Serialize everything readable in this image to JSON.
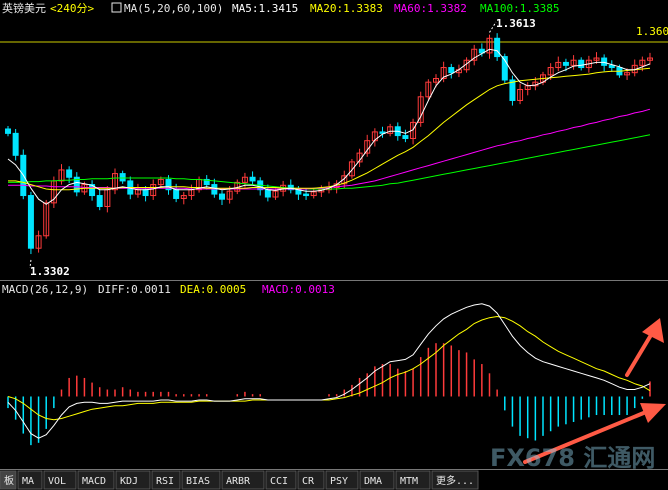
{
  "header": {
    "symbol": "英镑美元",
    "period": "<240分>",
    "ma_params": "MA(5,20,60,100)",
    "ma5": "MA5:1.3415",
    "ma20": "MA20:1.3383",
    "ma60": "MA60:1.3382",
    "ma100": "MA100:1.3385"
  },
  "price_labels": {
    "high": "1.3613",
    "low": "1.3302",
    "right_level": "1.3600"
  },
  "macd_header": {
    "params": "MACD(26,12,9)",
    "diff": "DIFF:0.0011",
    "dea": "DEA:0.0005",
    "macd": "MACD:0.0013"
  },
  "tabs": [
    "板",
    "MA",
    "VOL",
    "MACD",
    "KDJ",
    "RSI",
    "BIAS",
    "ARBR",
    "CCI",
    "CR",
    "PSY",
    "DMA",
    "MTM",
    "更多..."
  ],
  "watermark": "FX678 汇通网",
  "colors": {
    "up": "#ff3b3b",
    "down": "#00e5ff",
    "ma5": "#ffffff",
    "ma20": "#ffff00",
    "ma60": "#ff00ff",
    "ma100": "#00ff00",
    "arrow": "#ff5a45",
    "level_line": "#cccc00"
  },
  "chart_data": [
    {
      "type": "candlestick",
      "series_names": [
        "MA5",
        "MA20",
        "MA60",
        "MA100"
      ],
      "ylim": [
        1.328,
        1.363
      ],
      "level_line": 1.36,
      "annotations": [
        {
          "label": "1.3613",
          "value": 1.3613
        },
        {
          "label": "1.3302",
          "value": 1.3302
        }
      ],
      "close": [
        1.3475,
        1.3445,
        1.339,
        1.3318,
        1.3335,
        1.338,
        1.341,
        1.3425,
        1.3415,
        1.3395,
        1.3405,
        1.339,
        1.3375,
        1.3398,
        1.342,
        1.341,
        1.3392,
        1.3398,
        1.339,
        1.3405,
        1.3412,
        1.3398,
        1.3386,
        1.339,
        1.3398,
        1.3412,
        1.3405,
        1.3392,
        1.3385,
        1.3396,
        1.3408,
        1.3415,
        1.341,
        1.3398,
        1.3388,
        1.3396,
        1.3404,
        1.3398,
        1.3392,
        1.339,
        1.3395,
        1.3398,
        1.3401,
        1.3406,
        1.3417,
        1.3436,
        1.3448,
        1.3465,
        1.3477,
        1.3475,
        1.3484,
        1.3472,
        1.3468,
        1.349,
        1.3525,
        1.3545,
        1.355,
        1.3565,
        1.3558,
        1.3562,
        1.3575,
        1.359,
        1.3585,
        1.3605,
        1.358,
        1.3548,
        1.352,
        1.3535,
        1.354,
        1.3545,
        1.3555,
        1.3565,
        1.3572,
        1.3568,
        1.3575,
        1.3565,
        1.3575,
        1.3578,
        1.3568,
        1.3565,
        1.3555,
        1.3558,
        1.3568,
        1.3575,
        1.3578
      ],
      "ma5": [
        1.344,
        1.3432,
        1.3418,
        1.34,
        1.3385,
        1.3378,
        1.3385,
        1.3398,
        1.3405,
        1.3408,
        1.3406,
        1.3404,
        1.3398,
        1.3398,
        1.34,
        1.3402,
        1.34,
        1.3398,
        1.3398,
        1.3399,
        1.3402,
        1.3402,
        1.3398,
        1.3398,
        1.3398,
        1.34,
        1.3402,
        1.34,
        1.3398,
        1.3399,
        1.3401,
        1.3404,
        1.3404,
        1.3402,
        1.3398,
        1.3397,
        1.3399,
        1.34,
        1.3398,
        1.3396,
        1.3396,
        1.3397,
        1.34,
        1.3405,
        1.3413,
        1.3425,
        1.3438,
        1.3452,
        1.3466,
        1.3474,
        1.3478,
        1.3478,
        1.3475,
        1.348,
        1.3498,
        1.352,
        1.354,
        1.3552,
        1.3556,
        1.3562,
        1.357,
        1.3578,
        1.3584,
        1.359,
        1.3588,
        1.3575,
        1.3558,
        1.3545,
        1.354,
        1.3541,
        1.3545,
        1.3552,
        1.3558,
        1.3562,
        1.3567,
        1.3568,
        1.357,
        1.3572,
        1.3572,
        1.3569,
        1.3566,
        1.3562,
        1.3562,
        1.3566,
        1.357
      ],
      "ma20": [
        1.341,
        1.341,
        1.3408,
        1.3405,
        1.3402,
        1.3399,
        1.3398,
        1.3398,
        1.3398,
        1.3399,
        1.34,
        1.34,
        1.34,
        1.34,
        1.34,
        1.3401,
        1.3401,
        1.3401,
        1.3401,
        1.3401,
        1.3401,
        1.3402,
        1.3402,
        1.3402,
        1.3401,
        1.3401,
        1.34,
        1.34,
        1.34,
        1.34,
        1.34,
        1.34,
        1.3401,
        1.3401,
        1.3401,
        1.3401,
        1.34,
        1.34,
        1.34,
        1.34,
        1.34,
        1.3401,
        1.3402,
        1.3404,
        1.3407,
        1.3411,
        1.3416,
        1.3421,
        1.3427,
        1.3433,
        1.3439,
        1.3445,
        1.345,
        1.3456,
        1.3464,
        1.3472,
        1.3481,
        1.349,
        1.3498,
        1.3506,
        1.3514,
        1.3521,
        1.3528,
        1.3535,
        1.354,
        1.3543,
        1.3545,
        1.3547,
        1.3548,
        1.3549,
        1.355,
        1.3551,
        1.3552,
        1.3553,
        1.3554,
        1.3555,
        1.3556,
        1.3558,
        1.3559,
        1.356,
        1.356,
        1.3561,
        1.3562,
        1.3563,
        1.3564
      ],
      "ma60": [
        1.3404,
        1.3404,
        1.3404,
        1.3403,
        1.3403,
        1.3403,
        1.3402,
        1.3402,
        1.3402,
        1.3402,
        1.3401,
        1.3401,
        1.3401,
        1.3401,
        1.34,
        1.34,
        1.34,
        1.34,
        1.34,
        1.34,
        1.34,
        1.34,
        1.34,
        1.34,
        1.3399,
        1.3399,
        1.3399,
        1.3399,
        1.3399,
        1.3399,
        1.3399,
        1.3399,
        1.3399,
        1.3399,
        1.3399,
        1.3399,
        1.3399,
        1.3399,
        1.3399,
        1.3399,
        1.34,
        1.34,
        1.3401,
        1.3402,
        1.3403,
        1.3404,
        1.3406,
        1.3408,
        1.341,
        1.3413,
        1.3416,
        1.3419,
        1.3422,
        1.3425,
        1.3428,
        1.3431,
        1.3434,
        1.3437,
        1.344,
        1.3443,
        1.3446,
        1.3449,
        1.3452,
        1.3455,
        1.3458,
        1.346,
        1.3463,
        1.3465,
        1.3468,
        1.347,
        1.3473,
        1.3475,
        1.3478,
        1.348,
        1.3483,
        1.3485,
        1.3488,
        1.349,
        1.3493,
        1.3495,
        1.3498,
        1.35,
        1.3503,
        1.3505,
        1.3508
      ],
      "ma100": [
        1.3408,
        1.3408,
        1.3408,
        1.3409,
        1.3409,
        1.341,
        1.341,
        1.3411,
        1.3411,
        1.3412,
        1.3412,
        1.3413,
        1.3413,
        1.3413,
        1.3414,
        1.3414,
        1.3414,
        1.3414,
        1.3414,
        1.3414,
        1.3414,
        1.3414,
        1.3413,
        1.3413,
        1.3412,
        1.3412,
        1.3411,
        1.341,
        1.3409,
        1.3408,
        1.3407,
        1.3406,
        1.3405,
        1.3404,
        1.3403,
        1.3402,
        1.3401,
        1.34,
        1.34,
        1.3399,
        1.3399,
        1.3399,
        1.3399,
        1.3399,
        1.34,
        1.34,
        1.3401,
        1.3402,
        1.3403,
        1.3404,
        1.3406,
        1.3407,
        1.3409,
        1.3411,
        1.3413,
        1.3415,
        1.3417,
        1.3419,
        1.3421,
        1.3423,
        1.3425,
        1.3427,
        1.3429,
        1.3431,
        1.3433,
        1.3435,
        1.3437,
        1.3439,
        1.3441,
        1.3443,
        1.3445,
        1.3447,
        1.3449,
        1.3451,
        1.3453,
        1.3455,
        1.3457,
        1.3459,
        1.3461,
        1.3463,
        1.3465,
        1.3467,
        1.3469,
        1.3471,
        1.3473
      ]
    },
    {
      "type": "bar+line",
      "series_names": [
        "DIFF",
        "DEA",
        "MACD"
      ],
      "ylim": [
        -0.006,
        0.0085
      ],
      "diff": [
        -0.0005,
        -0.0012,
        -0.0022,
        -0.0032,
        -0.0036,
        -0.0033,
        -0.0025,
        -0.0016,
        -0.0009,
        -0.0006,
        -0.0005,
        -0.0005,
        -0.0006,
        -0.0006,
        -0.0005,
        -0.0004,
        -0.0004,
        -0.0004,
        -0.0004,
        -0.0004,
        -0.0003,
        -0.0003,
        -0.0004,
        -0.0004,
        -0.0004,
        -0.0003,
        -0.0003,
        -0.0004,
        -0.0004,
        -0.0004,
        -0.0003,
        -0.0002,
        -0.0002,
        -0.0002,
        -0.0003,
        -0.0003,
        -0.0003,
        -0.0003,
        -0.0003,
        -0.0003,
        -0.0003,
        -0.0003,
        -0.0002,
        -0.0001,
        0.0002,
        0.0006,
        0.0011,
        0.0016,
        0.0022,
        0.0026,
        0.003,
        0.0031,
        0.0032,
        0.0036,
        0.0045,
        0.0054,
        0.0061,
        0.0067,
        0.0071,
        0.0074,
        0.0077,
        0.0079,
        0.008,
        0.0078,
        0.0072,
        0.0062,
        0.0052,
        0.0044,
        0.0038,
        0.0033,
        0.003,
        0.0028,
        0.0026,
        0.0024,
        0.0022,
        0.002,
        0.0018,
        0.0016,
        0.0014,
        0.0011,
        0.0008,
        0.0006,
        0.0006,
        0.0008,
        0.0011
      ],
      "dea": [
        0.0,
        -0.0002,
        -0.0006,
        -0.0011,
        -0.0016,
        -0.0019,
        -0.002,
        -0.0019,
        -0.0017,
        -0.0015,
        -0.0013,
        -0.0011,
        -0.001,
        -0.0009,
        -0.0008,
        -0.0008,
        -0.0007,
        -0.0006,
        -0.0006,
        -0.0006,
        -0.0005,
        -0.0005,
        -0.0005,
        -0.0005,
        -0.0005,
        -0.0004,
        -0.0004,
        -0.0004,
        -0.0004,
        -0.0004,
        -0.0004,
        -0.0004,
        -0.0003,
        -0.0003,
        -0.0003,
        -0.0003,
        -0.0003,
        -0.0003,
        -0.0003,
        -0.0003,
        -0.0003,
        -0.0003,
        -0.0003,
        -0.0002,
        -0.0001,
        0.0001,
        0.0003,
        0.0006,
        0.0009,
        0.0012,
        0.0016,
        0.0019,
        0.0021,
        0.0024,
        0.0028,
        0.0033,
        0.0038,
        0.0044,
        0.0049,
        0.0054,
        0.0058,
        0.0063,
        0.0066,
        0.0068,
        0.0069,
        0.0068,
        0.0065,
        0.0061,
        0.0056,
        0.0052,
        0.0047,
        0.0043,
        0.0039,
        0.0036,
        0.0033,
        0.003,
        0.0027,
        0.0024,
        0.0022,
        0.0019,
        0.0016,
        0.0014,
        0.0011,
        0.0009,
        0.0005
      ],
      "macd": [
        -0.001,
        -0.002,
        -0.0032,
        -0.0042,
        -0.004,
        -0.0028,
        -0.001,
        0.0006,
        0.0016,
        0.0018,
        0.0016,
        0.0012,
        0.0008,
        0.0006,
        0.0006,
        0.0008,
        0.0006,
        0.0004,
        0.0004,
        0.0004,
        0.0004,
        0.0004,
        0.0002,
        0.0002,
        0.0002,
        0.0002,
        0.0002,
        0.0,
        0.0,
        0.0,
        0.0002,
        0.0004,
        0.0002,
        0.0002,
        0.0,
        0.0,
        0.0,
        0.0,
        0.0,
        0.0,
        0.0,
        0.0,
        0.0002,
        0.0002,
        0.0006,
        0.001,
        0.0016,
        0.002,
        0.0026,
        0.0028,
        0.0028,
        0.0024,
        0.0022,
        0.0024,
        0.0034,
        0.0042,
        0.0046,
        0.0046,
        0.0044,
        0.004,
        0.0038,
        0.0032,
        0.0028,
        0.002,
        0.0006,
        -0.0012,
        -0.0026,
        -0.0034,
        -0.0036,
        -0.0038,
        -0.0034,
        -0.003,
        -0.0026,
        -0.0024,
        -0.0022,
        -0.002,
        -0.0018,
        -0.0016,
        -0.0016,
        -0.0016,
        -0.0016,
        -0.0016,
        -0.001,
        -0.0002,
        0.0013
      ]
    }
  ]
}
